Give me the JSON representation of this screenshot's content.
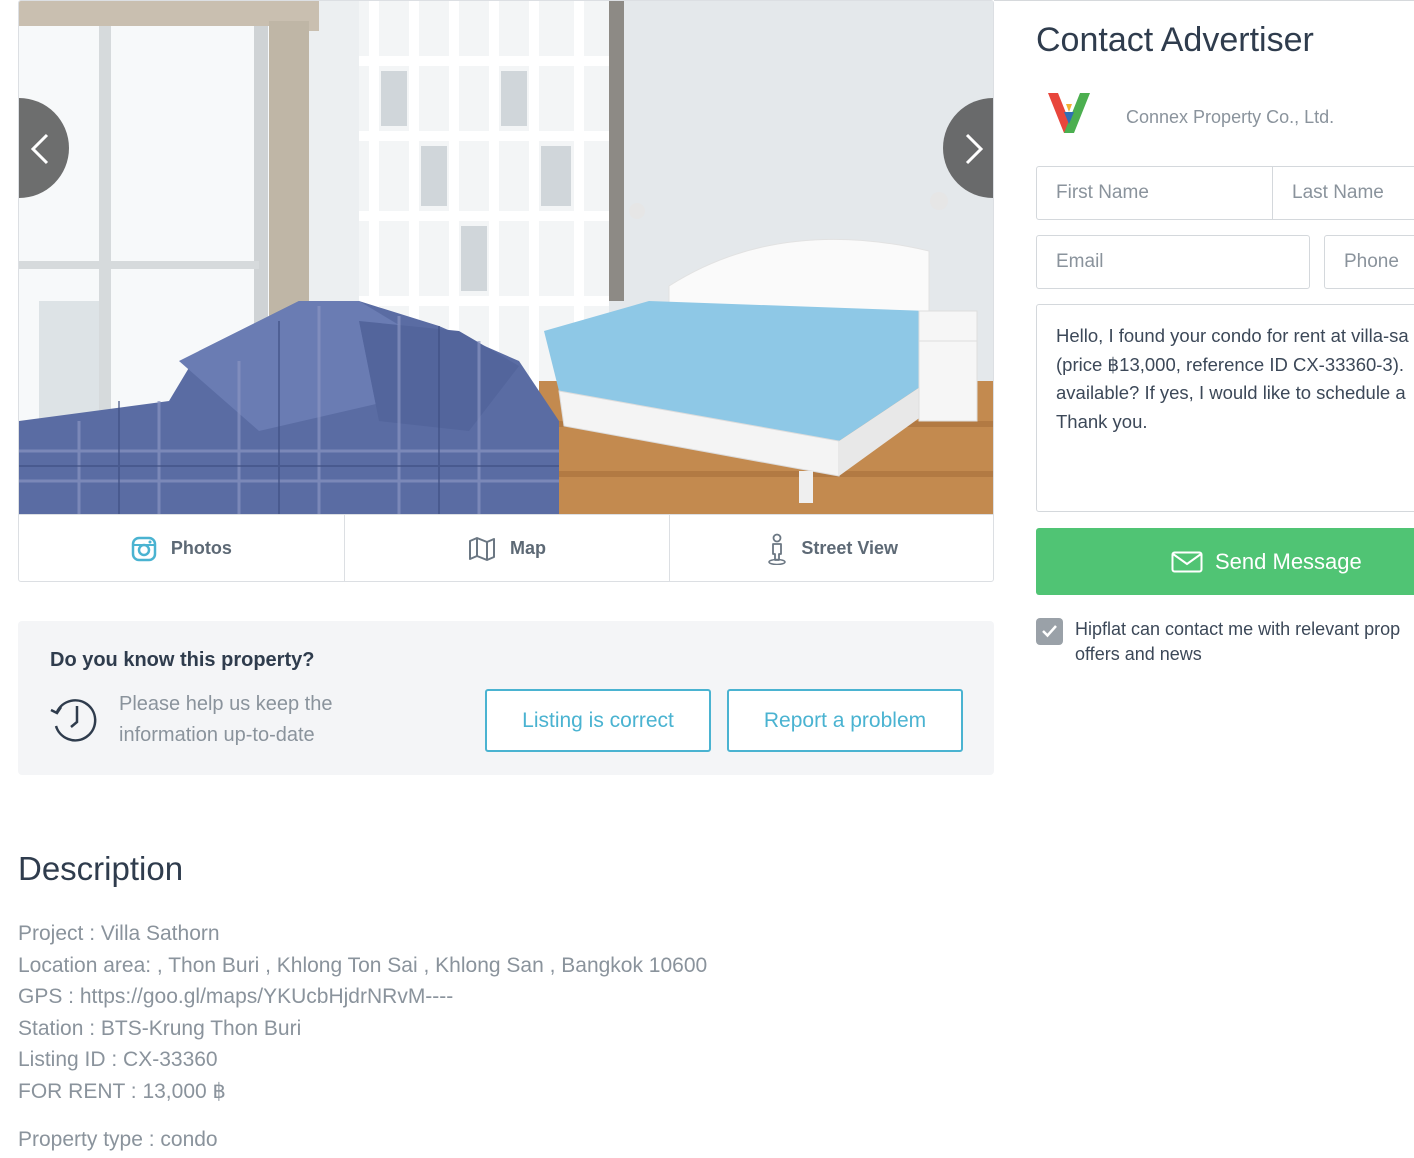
{
  "gallery": {
    "tabs": [
      {
        "label": "Photos",
        "icon": "instagram-icon"
      },
      {
        "label": "Map",
        "icon": "map-icon"
      },
      {
        "label": "Street View",
        "icon": "pegman-icon"
      }
    ]
  },
  "know": {
    "title": "Do you know this property?",
    "text_line1": "Please help us keep the",
    "text_line2": "information up-to-date",
    "correct_label": "Listing is correct",
    "report_label": "Report a problem",
    "accent": "#4ab3d1"
  },
  "description": {
    "title": "Description",
    "lines": [
      "Project : Villa Sathorn",
      "Location area: , Thon Buri , Khlong Ton Sai , Khlong San , Bangkok 10600",
      "GPS : https://goo.gl/maps/YKUcbHjdrNRvM----",
      "Station : BTS-Krung Thon Buri",
      "Listing ID : CX-33360",
      "FOR RENT : 13,000 ฿"
    ],
    "property_type": "Property type : condo"
  },
  "contact": {
    "title": "Contact Advertiser",
    "agent_name": "Connex Property Co., Ltd.",
    "first_name_placeholder": "First Name",
    "last_name_placeholder": "Last Name",
    "email_placeholder": "Email",
    "phone_placeholder": "Phone",
    "message_lines": [
      "Hello, I found your condo for rent at villa-sa",
      "(price ฿13,000, reference ID CX-33360-3).",
      "available? If yes, I would like to schedule a",
      "Thank you."
    ],
    "send_label": "Send Message",
    "send_color": "#50c474",
    "consent_line1": "Hipflat can contact me with relevant prop",
    "consent_line2": "offers and news",
    "consent_checked": true
  }
}
